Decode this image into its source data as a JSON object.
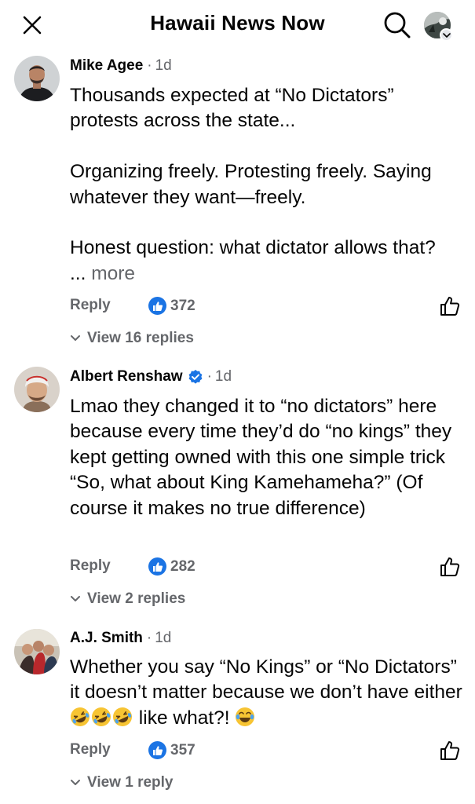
{
  "header": {
    "title": "Hawaii News Now",
    "close_icon": "close-icon",
    "search_icon": "search-icon",
    "profile_icon": "profile-avatar",
    "chevron_icon": "chevron-down-icon"
  },
  "colors": {
    "accent": "#1b74e4",
    "secondary_text": "#65676b",
    "primary_text": "#050505"
  },
  "comments": [
    {
      "author": "Mike Agee",
      "verified": false,
      "separator": "·",
      "time": "1d",
      "text": "Thousands expected at “No Dictators” protests across the state...\n\nOrganizing freely. Protesting freely. Saying whatever they want—freely.\n\nHonest question: what dictator allows that?\n...",
      "more_label": "more",
      "reply_label": "Reply",
      "reaction_count": "372",
      "view_replies": "View 16 replies"
    },
    {
      "author": "Albert Renshaw",
      "verified": true,
      "separator": "·",
      "time": "1d",
      "text": "Lmao they changed it to “no dictators” here because every time they’d do “no kings” they kept getting owned with this one simple trick “So, what about King Kamehameha?” (Of course it makes no true difference)",
      "reply_label": "Reply",
      "reaction_count": "282",
      "view_replies": "View 2 replies"
    },
    {
      "author": "A.J. Smith",
      "verified": false,
      "separator": "·",
      "time": "1d",
      "text_before": "Whether you say “No Kings” or “No Dictators” it doesn’t matter because we don’t have either ",
      "text_middle": " like what?! ",
      "emoji_names": [
        "rofl-emoji",
        "rofl-emoji",
        "rofl-emoji",
        "joy-emoji"
      ],
      "reply_label": "Reply",
      "reaction_count": "357",
      "view_replies": "View 1 reply"
    }
  ]
}
